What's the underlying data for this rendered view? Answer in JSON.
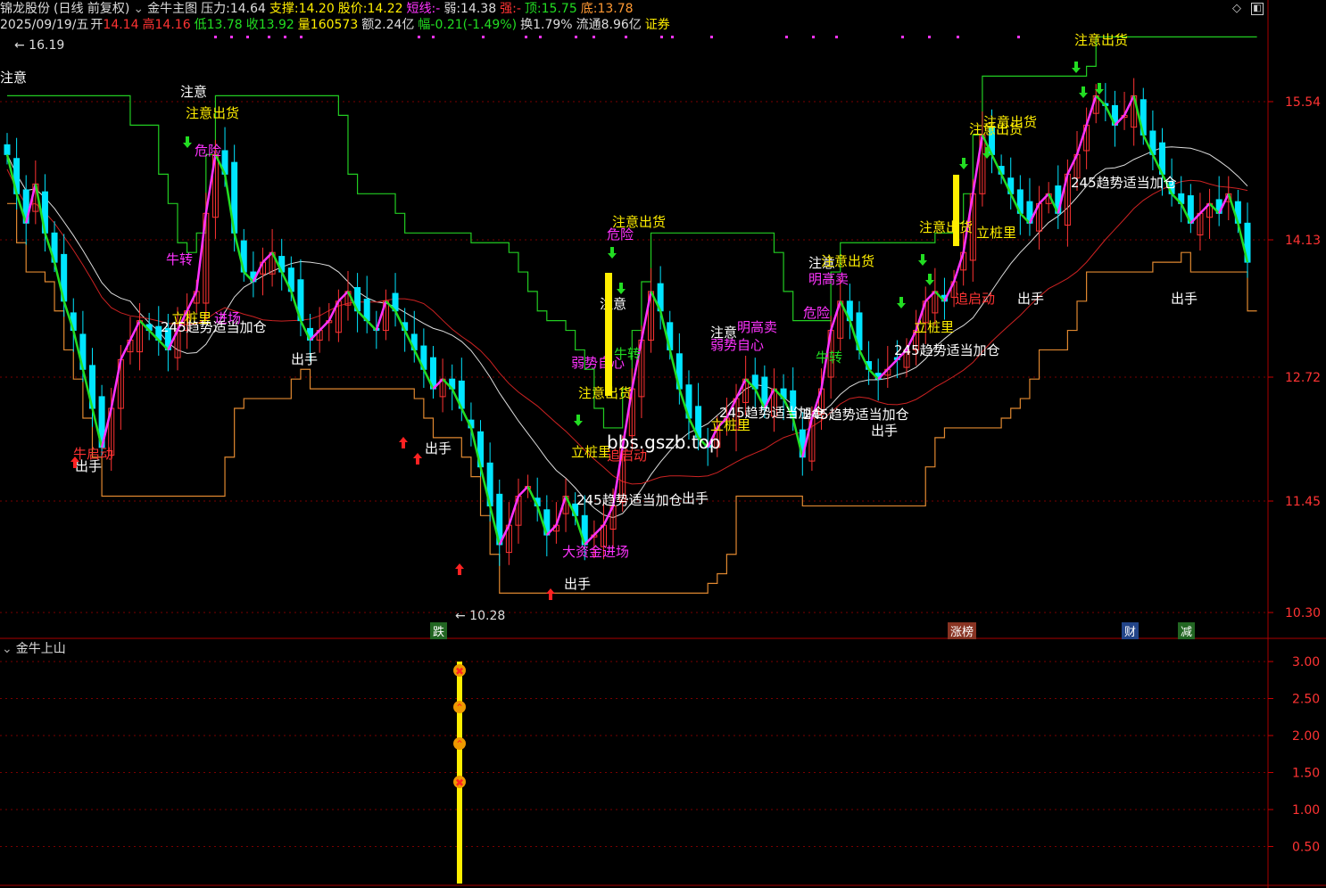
{
  "header": {
    "stock_name": "锦龙股份",
    "period": "(日线 前复权)",
    "indicator": "金牛主图",
    "pressure_label": "压力:",
    "pressure_value": "14.64",
    "support_label": "支撑:",
    "support_value": "14.20",
    "price_label": "股价:",
    "price_value": "14.22",
    "short_label": "短线:",
    "short_value": "-",
    "weak_label": "弱:",
    "weak_value": "14.38",
    "strong_label": "强:",
    "strong_value": "-",
    "top_label": "顶:",
    "top_value": "15.75",
    "bottom_label": "底:",
    "bottom_value": "13.78"
  },
  "info": {
    "date": "2025/09/19/五",
    "open_label": "开",
    "open": "14.14",
    "high_label": "高",
    "high": "14.16",
    "low_label": "低",
    "low": "13.78",
    "close_label": "收",
    "close": "13.92",
    "vol_label": "量",
    "vol": "160573",
    "amount": "额2.24亿",
    "change": "幅-0.21(-1.49%)",
    "turnover": "换1.79%",
    "float_cap": "流通8.96亿",
    "sector": "证券"
  },
  "sub_panel_title": "金牛上山",
  "watermark": "bbs.gszb.top",
  "colors": {
    "bg": "#000000",
    "up": "#ff3333",
    "down": "#00e5ff",
    "green": "#22dd22",
    "magenta": "#ff33ff",
    "yellow": "#ffee00",
    "orange": "#ff9933",
    "white": "#ffffff",
    "grid": "#7a0000"
  },
  "chart_data": [
    {
      "type": "candlestick",
      "title": "金牛主图",
      "y_ticks": [
        "15.54",
        "14.13",
        "12.72",
        "11.45",
        "10.30"
      ],
      "ylim": [
        10.2,
        16.3
      ],
      "high_marker": "16.19",
      "low_marker": "10.28",
      "close_path": [
        15.0,
        14.6,
        14.3,
        14.7,
        14.2,
        13.9,
        13.5,
        13.2,
        12.8,
        12.4,
        12.0,
        12.4,
        12.9,
        13.1,
        13.3,
        13.2,
        13.1,
        13.0,
        13.2,
        13.4,
        13.6,
        14.4,
        15.0,
        14.8,
        14.2,
        13.8,
        13.7,
        13.9,
        14.0,
        13.8,
        13.6,
        13.3,
        13.1,
        13.2,
        13.3,
        13.5,
        13.6,
        13.4,
        13.3,
        13.2,
        13.5,
        13.4,
        13.2,
        13.0,
        12.8,
        12.6,
        12.7,
        12.6,
        12.4,
        12.2,
        11.8,
        11.4,
        11.0,
        11.2,
        11.5,
        11.6,
        11.4,
        11.1,
        11.2,
        11.5,
        11.3,
        11.0,
        11.1,
        11.2,
        11.4,
        12.0,
        12.6,
        13.1,
        13.6,
        13.4,
        13.0,
        12.6,
        12.3,
        12.1,
        12.0,
        12.2,
        12.3,
        12.5,
        12.7,
        12.6,
        12.4,
        12.6,
        12.5,
        12.3,
        11.9,
        12.3,
        12.6,
        13.2,
        13.5,
        13.3,
        13.0,
        12.8,
        12.7,
        12.8,
        12.9,
        13.0,
        13.2,
        13.5,
        13.6,
        13.5,
        13.7,
        14.0,
        14.6,
        15.2,
        15.0,
        14.8,
        14.6,
        14.4,
        14.3,
        14.5,
        14.6,
        14.4,
        14.8,
        15.0,
        15.3,
        15.6,
        15.5,
        15.3,
        15.4,
        15.6,
        15.2,
        15.0,
        14.8,
        14.6,
        14.5,
        14.3,
        14.4,
        14.5,
        14.4,
        14.6,
        14.3,
        13.9
      ]
    },
    {
      "type": "bar",
      "title": "金牛上山",
      "y_ticks": [
        "3.00",
        "2.50",
        "2.00",
        "1.50",
        "1.00",
        "0.50"
      ],
      "ylim": [
        0.0,
        3.0
      ],
      "values": [
        3.0
      ]
    }
  ],
  "annotations": {
    "attention": "注意",
    "attention_ship": "注意出货",
    "danger": "危险",
    "out": "出手",
    "trend_add": "245趋势适当加仓",
    "pile": "立桩里",
    "bull_turn": "牛转",
    "start": "追启动",
    "bull_start": "牛启动",
    "weak_self": "弱势自心",
    "bright_sell": "明高卖",
    "big_fund": "大资金进场",
    "enter": "进场",
    "trend_add2": "245趋势适当加仓"
  },
  "bottom_tags": [
    "跌",
    "涨榜",
    "财",
    "减"
  ]
}
